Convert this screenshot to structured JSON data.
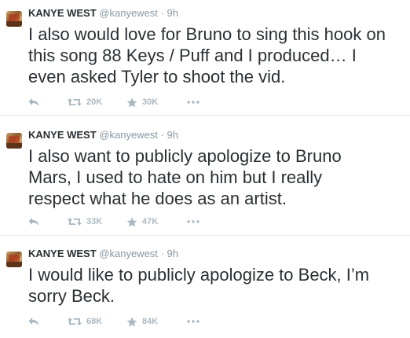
{
  "tweets": [
    {
      "name": "KANYE WEST",
      "handle": "@kanyewest",
      "separator": "·",
      "time": "9h",
      "text": "I also would love for Bruno to sing this hook on\nthis song 88 Keys / Puff and I produced…   I\neven asked Tyler to shoot the vid.",
      "retweets": "20K",
      "favorites": "30K"
    },
    {
      "name": "KANYE WEST",
      "handle": "@kanyewest",
      "separator": "·",
      "time": "9h",
      "text": "I also want to publicly apologize to Bruno\nMars,  I used to hate on him but I really\nrespect what he does as an artist.",
      "retweets": "33K",
      "favorites": "47K"
    },
    {
      "name": "KANYE WEST",
      "handle": "@kanyewest",
      "separator": "·",
      "time": "9h",
      "text": "I would like to publicly apologize to Beck, I’m\nsorry Beck.",
      "retweets": "68K",
      "favorites": "84K"
    }
  ],
  "icons": {
    "reply": "reply-icon",
    "retweet": "retweet-icon",
    "favorite": "star-icon",
    "more": "more-icon"
  },
  "colors": {
    "text": "#292f33",
    "muted": "#8899a6",
    "action": "#aab8c2",
    "divider": "#e1e8ed"
  }
}
